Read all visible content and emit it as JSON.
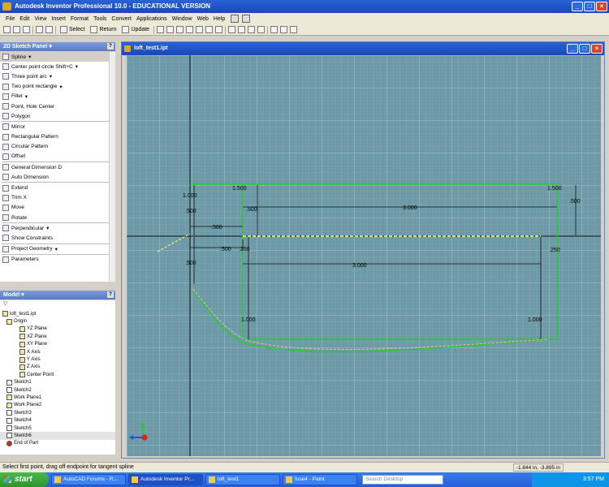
{
  "app": {
    "title": "Autodesk Inventor Professional 10.0 - EDUCATIONAL VERSION"
  },
  "menu": [
    "File",
    "Edit",
    "View",
    "Insert",
    "Format",
    "Tools",
    "Convert",
    "Applications",
    "Window",
    "Web",
    "Help"
  ],
  "toolbar": {
    "select_label": "Select",
    "return_label": "Return",
    "update_label": "Update"
  },
  "sketch_panel": {
    "title": "2D Sketch Panel",
    "items": [
      {
        "label": "Spline"
      },
      {
        "label": "Center point circle   Shift+C"
      },
      {
        "label": "Three point arc"
      },
      {
        "label": "Two point rectangle"
      },
      {
        "label": "Fillet"
      },
      {
        "label": "Point, Hole Center"
      },
      {
        "label": "Polygon"
      },
      {
        "label": "Mirror"
      },
      {
        "label": "Rectangular Pattern"
      },
      {
        "label": "Circular Pattern"
      },
      {
        "label": "Offset"
      },
      {
        "label": "General Dimension   D"
      },
      {
        "label": "Auto Dimension"
      },
      {
        "label": "Extend"
      },
      {
        "label": "Trim   X"
      },
      {
        "label": "Move"
      },
      {
        "label": "Rotate"
      },
      {
        "label": "Perpendicular"
      },
      {
        "label": "Show Constraints"
      },
      {
        "label": "Project Geometry"
      },
      {
        "label": "Parameters"
      }
    ]
  },
  "model_panel": {
    "title": "Model",
    "tree": [
      {
        "label": "loft_test1.ipt",
        "level": 0
      },
      {
        "label": "Origin",
        "level": 1
      },
      {
        "label": "YZ Plane",
        "level": 2
      },
      {
        "label": "XZ Plane",
        "level": 2
      },
      {
        "label": "XY Plane",
        "level": 2
      },
      {
        "label": "X Axis",
        "level": 2
      },
      {
        "label": "Y Axis",
        "level": 2
      },
      {
        "label": "Z Axis",
        "level": 2
      },
      {
        "label": "Center Point",
        "level": 2
      },
      {
        "label": "Sketch1",
        "level": 1
      },
      {
        "label": "Sketch2",
        "level": 1
      },
      {
        "label": "Work Plane1",
        "level": 1
      },
      {
        "label": "Work Plane2",
        "level": 1
      },
      {
        "label": "Sketch3",
        "level": 1
      },
      {
        "label": "Sketch4",
        "level": 1
      },
      {
        "label": "Sketch5",
        "level": 1
      },
      {
        "label": "Sketch6",
        "level": 1
      },
      {
        "label": "End of Part",
        "level": 1
      }
    ]
  },
  "document": {
    "title": "loft_test1.ipt",
    "dimensions": {
      "d1": "1.000",
      "d2": "1.500",
      "d3": "1.500",
      "d4": ".500",
      "d5": ".500",
      "d6": ".500",
      "d7": "3.000",
      "d8": ".500",
      "d9": ".500",
      "d10": ".250",
      "d11": "3.000",
      "d12": ".250",
      "d13": ".500",
      "d14": "1.000",
      "d15": "1.000"
    }
  },
  "status": {
    "message": "Select first point, drag off endpoint for tangent spline",
    "coordinates": "-1.844 in, -3.895 in"
  },
  "taskbar": {
    "start_label": "start",
    "tasks": [
      "AutoCAD Forums - R...",
      "Autodesk Inventor Pr...",
      "loft_test1",
      "fuse4 - Paint"
    ],
    "search_placeholder": "Search Desktop",
    "clock": "3:57 PM"
  },
  "colors": {
    "canvas_bg": "#6d9aa6",
    "sketch_green": "#1fd01f",
    "title_blue": "#2a63d6"
  }
}
